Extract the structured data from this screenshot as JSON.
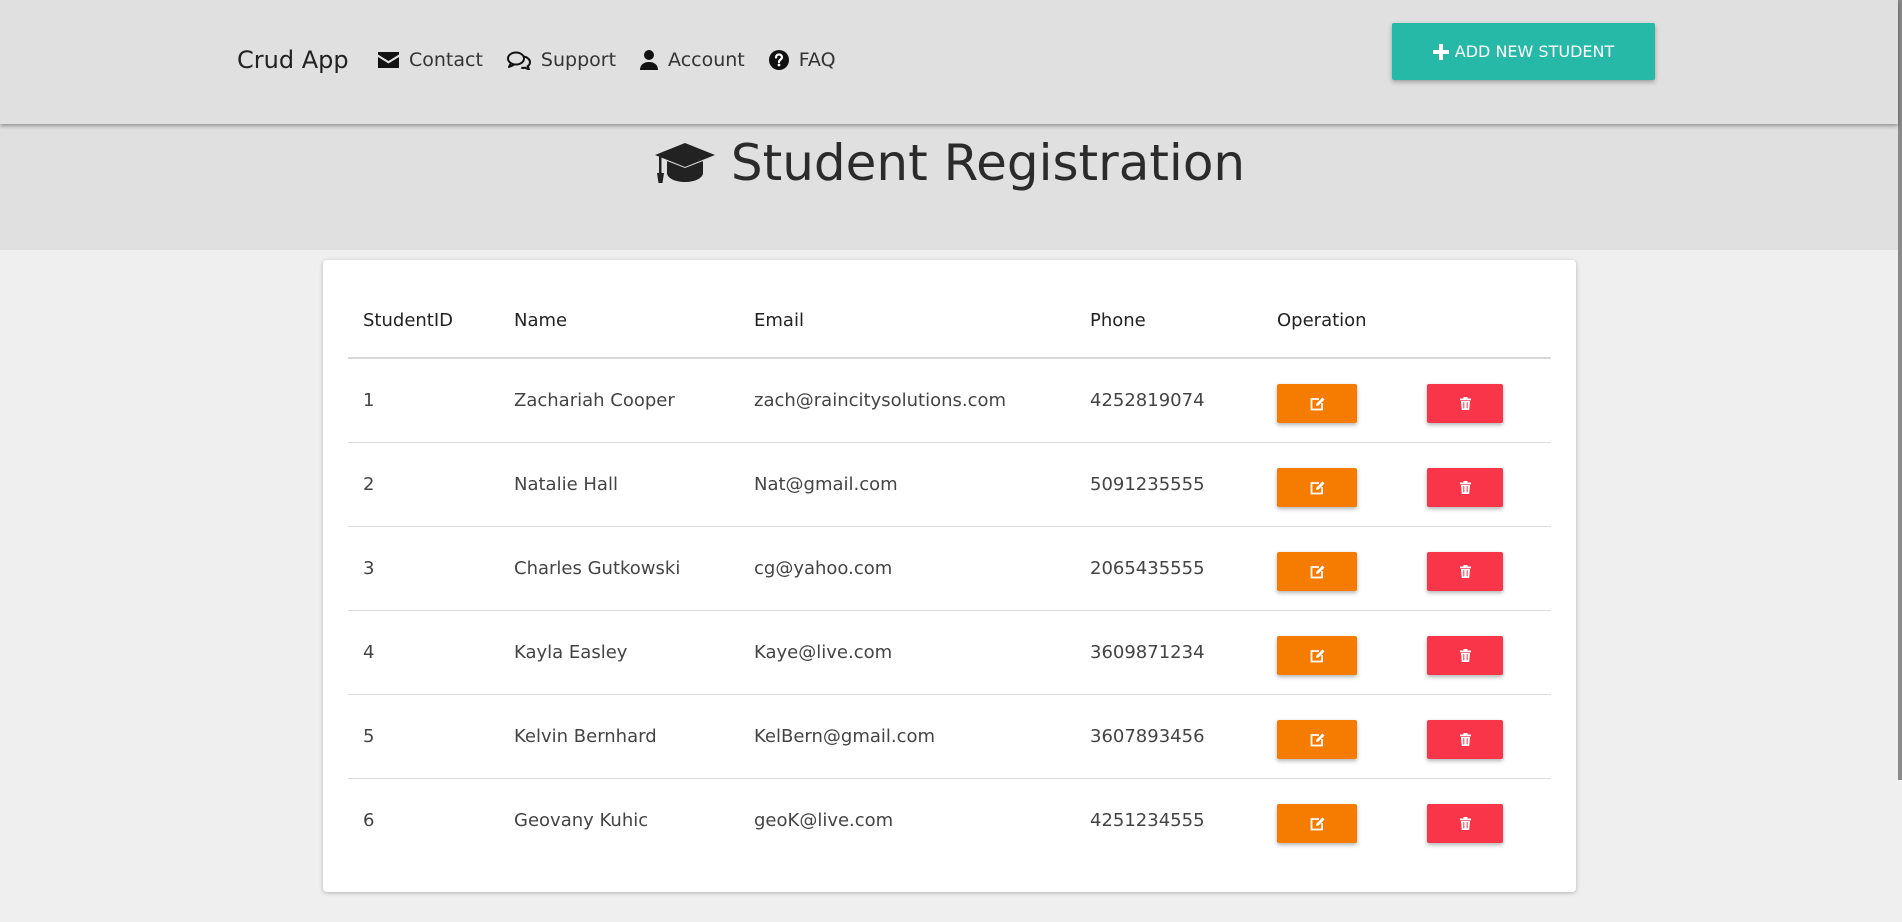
{
  "nav": {
    "brand": "Crud App",
    "links": [
      {
        "label": "Contact",
        "icon": "envelope-icon"
      },
      {
        "label": "Support",
        "icon": "comments-icon"
      },
      {
        "label": "Account",
        "icon": "user-icon"
      },
      {
        "label": "FAQ",
        "icon": "question-circle-icon"
      }
    ],
    "add_button": "ADD NEW STUDENT"
  },
  "page": {
    "title": "Student Registration",
    "title_icon": "graduation-cap-icon"
  },
  "table": {
    "headers": [
      "StudentID",
      "Name",
      "Email",
      "Phone",
      "Operation"
    ],
    "rows": [
      {
        "id": "1",
        "name": "Zachariah Cooper",
        "email": "zach@raincitysolutions.com",
        "phone": "4252819074"
      },
      {
        "id": "2",
        "name": "Natalie Hall",
        "email": "Nat@gmail.com",
        "phone": "5091235555"
      },
      {
        "id": "3",
        "name": "Charles Gutkowski",
        "email": "cg@yahoo.com",
        "phone": "2065435555"
      },
      {
        "id": "4",
        "name": "Kayla Easley",
        "email": "Kaye@live.com",
        "phone": "3609871234"
      },
      {
        "id": "5",
        "name": "Kelvin Bernhard",
        "email": "KelBern@gmail.com",
        "phone": "3607893456"
      },
      {
        "id": "6",
        "name": "Geovany Kuhic",
        "email": "geoK@live.com",
        "phone": "4251234555"
      }
    ]
  },
  "colors": {
    "header_bg": "#e0e0e0",
    "add_button": "#26b9a8",
    "edit_button": "#f57c00",
    "delete_button": "#f93549",
    "body_bg": "#efefef"
  }
}
